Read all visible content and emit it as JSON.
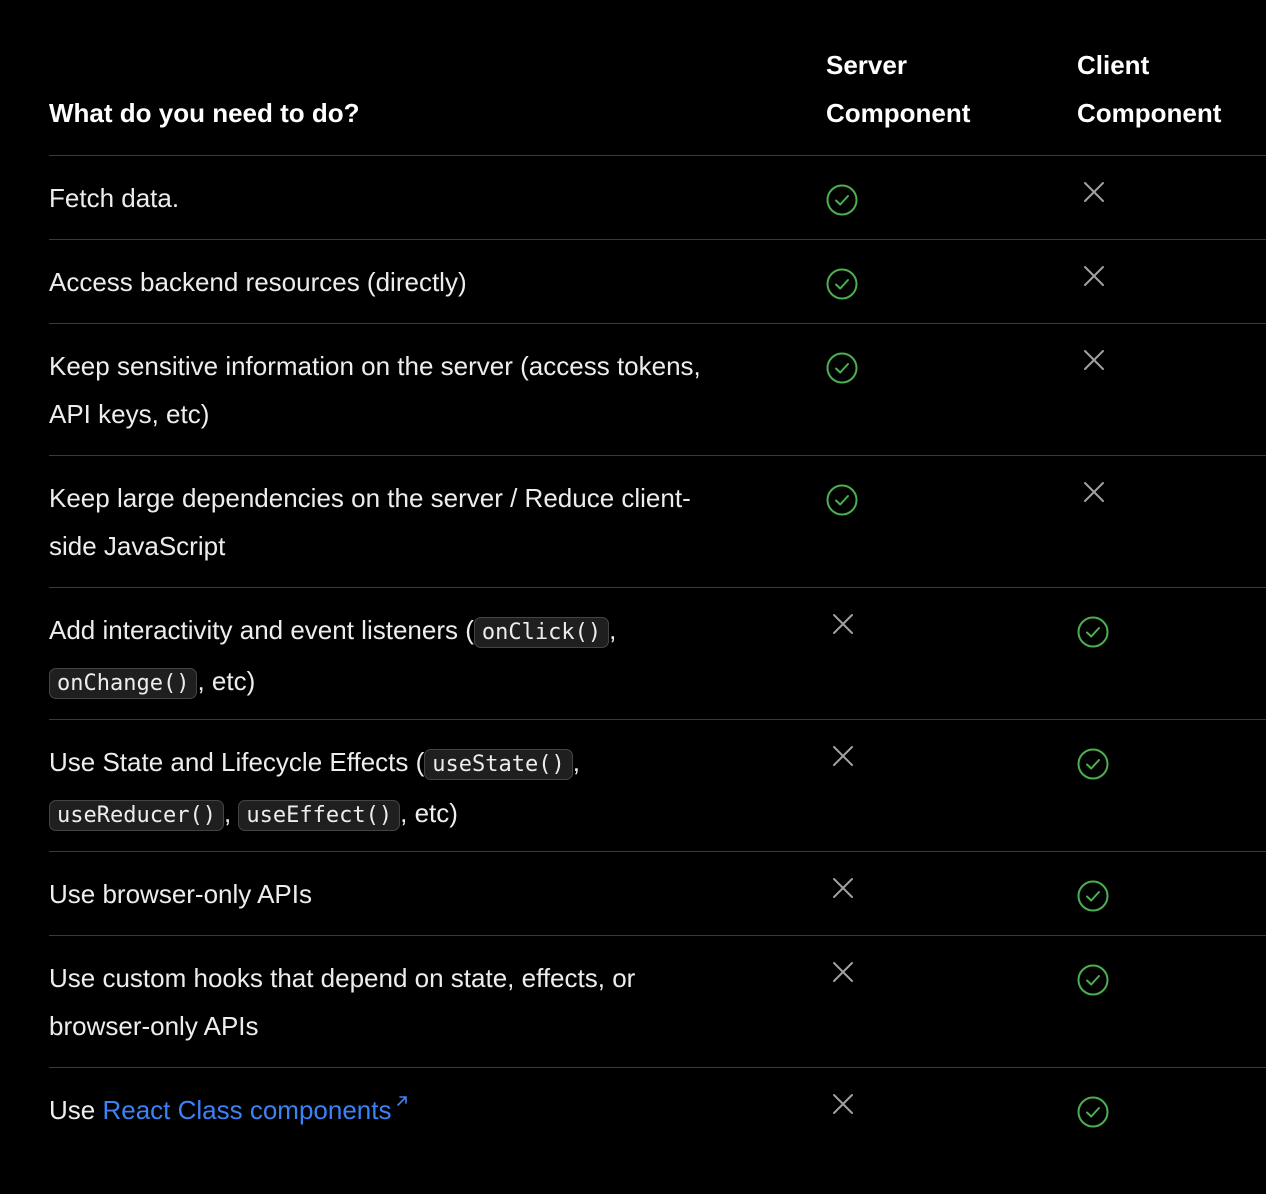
{
  "header": {
    "task": "What do you need to do?",
    "server_line1": "Server",
    "server_line2": "Component",
    "client_line1": "Client",
    "client_line2": "Component"
  },
  "rows": [
    {
      "text": "Fetch data.",
      "server": "check",
      "client": "cross"
    },
    {
      "text": "Access backend resources (directly)",
      "server": "check",
      "client": "cross"
    },
    {
      "text_line1": "Keep sensitive information on the server (access tokens,",
      "text_line2": "API keys, etc)",
      "server": "check",
      "client": "cross"
    },
    {
      "text_line1": "Keep large dependencies on the server / Reduce client-",
      "text_line2": "side JavaScript",
      "server": "check",
      "client": "cross"
    },
    {
      "prefix": "Add interactivity and event listeners (",
      "code1": "onClick()",
      "mid": ",",
      "code2": "onChange()",
      "suffix": ", etc)",
      "server": "cross",
      "client": "check"
    },
    {
      "prefix": "Use State and Lifecycle Effects (",
      "code1": "useState()",
      "mid1": ",",
      "code2": "useReducer()",
      "mid2": ",",
      "code3": "useEffect()",
      "suffix": ", etc)",
      "server": "cross",
      "client": "check"
    },
    {
      "text": "Use browser-only APIs",
      "server": "cross",
      "client": "check"
    },
    {
      "text_line1": "Use custom hooks that depend on state, effects, or",
      "text_line2": "browser-only APIs",
      "server": "cross",
      "client": "check"
    },
    {
      "prefix": "Use ",
      "link": "React Class components",
      "server": "cross",
      "client": "check"
    }
  ],
  "colors": {
    "background": "#000000",
    "check": "#4caf50",
    "cross": "#a1a1a1",
    "link": "#3b82f6"
  },
  "icons": {
    "check": "check-circle-icon",
    "cross": "cross-icon",
    "external": "external-link-icon"
  }
}
